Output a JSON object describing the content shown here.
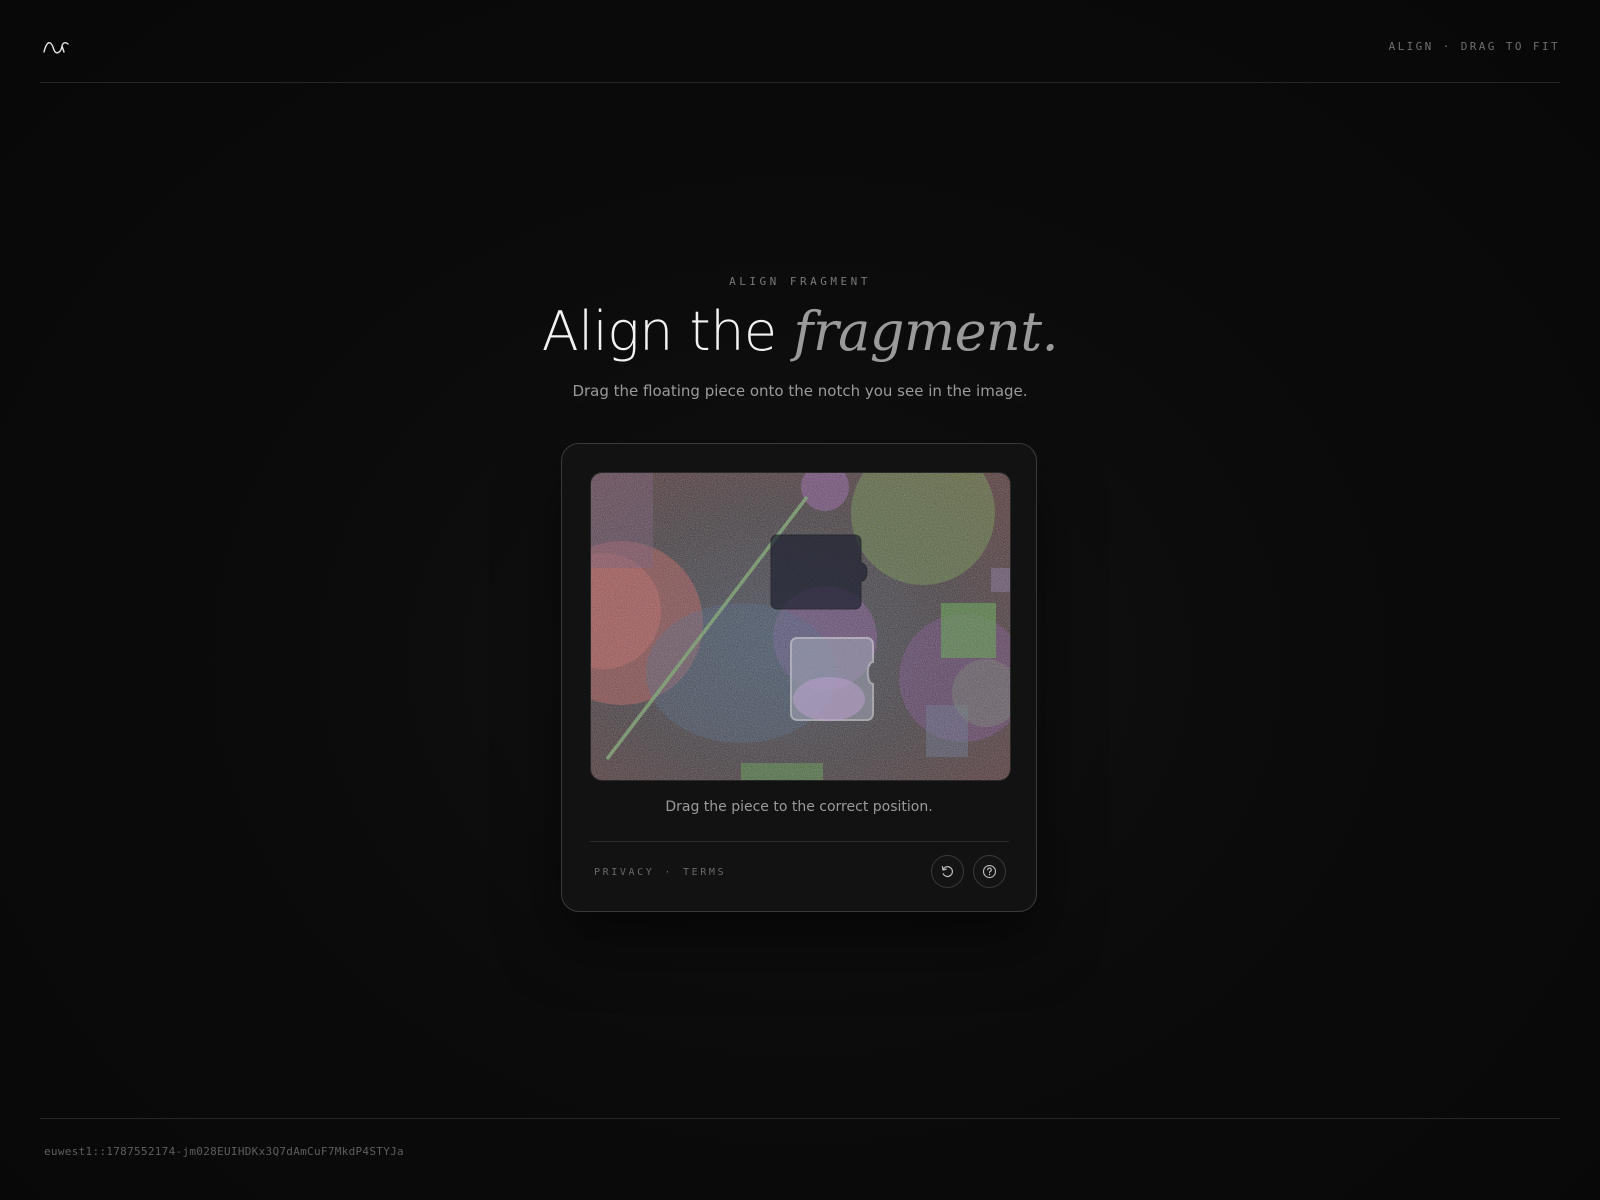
{
  "header": {
    "logo_icon": "wave-logo-icon",
    "status": "ALIGN · DRAG TO FIT"
  },
  "hero": {
    "eyebrow": "ALIGN FRAGMENT",
    "title_plain": "Align the ",
    "title_emphasis": "fragment.",
    "subtitle": "Drag the floating piece onto the notch you see in the image."
  },
  "captcha": {
    "instruction": "Drag the piece to the correct position.",
    "privacy_label": "PRIVACY",
    "separator": "·",
    "terms_label": "TERMS",
    "refresh_icon": "refresh-icon",
    "help_icon": "help-icon"
  },
  "footer": {
    "session_id": "euwest1::1787552174-jm028EUIHDKx3Q7dAmCuF7MkdP4STYJa"
  },
  "colors": {
    "background": "#0a0a0a",
    "card": "#121212",
    "accent_text": "#9a9a9a"
  }
}
